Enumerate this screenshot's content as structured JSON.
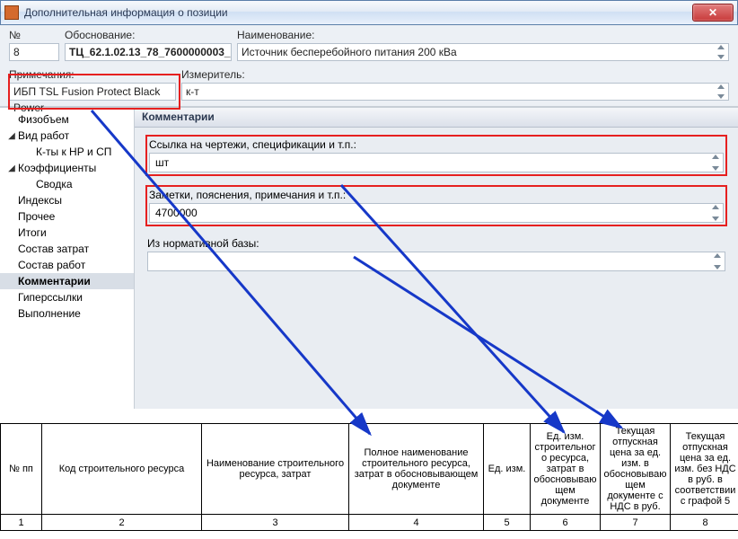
{
  "window": {
    "title": "Дополнительная информация о позиции"
  },
  "form": {
    "labels": {
      "no": "№",
      "obosn": "Обоснование:",
      "naim": "Наименование:",
      "prim": "Примечания:",
      "izm": "Измеритель:"
    },
    "values": {
      "no": "8",
      "obosn": "ТЦ_62.1.02.13_78_7600000003_",
      "naim": "Источник бесперебойного питания 200 кВа",
      "prim": "ИБП TSL Fusion Protect Black Power",
      "izm": "к-т"
    }
  },
  "sidebar": {
    "items": [
      {
        "label": "Физобъем",
        "caret": "",
        "cls": ""
      },
      {
        "label": "Вид работ",
        "caret": "◢",
        "cls": ""
      },
      {
        "label": "К-ты к НР и СП",
        "caret": "",
        "cls": "child"
      },
      {
        "label": "Коэффициенты",
        "caret": "◢",
        "cls": ""
      },
      {
        "label": "Сводка",
        "caret": "",
        "cls": "child"
      },
      {
        "label": "Индексы",
        "caret": "",
        "cls": ""
      },
      {
        "label": "Прочее",
        "caret": "",
        "cls": ""
      },
      {
        "label": "Итоги",
        "caret": "",
        "cls": ""
      },
      {
        "label": "Состав затрат",
        "caret": "",
        "cls": ""
      },
      {
        "label": "Состав работ",
        "caret": "",
        "cls": ""
      },
      {
        "label": "Комментарии",
        "caret": "",
        "cls": "selected"
      },
      {
        "label": "Гиперссылки",
        "caret": "",
        "cls": ""
      },
      {
        "label": "Выполнение",
        "caret": "",
        "cls": ""
      }
    ]
  },
  "comments": {
    "header": "Комментарии",
    "group1": {
      "label": "Ссылка на чертежи, спецификации и т.п.:",
      "value": "шт"
    },
    "group2": {
      "label": "Заметки, пояснения, примечания и т.п.:",
      "value": "4700000"
    },
    "group3": {
      "label": "Из нормативной базы:",
      "value": ""
    }
  },
  "table": {
    "headers": [
      "№ пп",
      "Код строительного ресурса",
      "Наименование строительного ресурса, затрат",
      "Полное наименование строительного ресурса, затрат в обосновывающем документе",
      "Ед. изм.",
      "Ед. изм. строительного ресурса, затрат в обосновывающем документе",
      "Текущая отпускная цена за ед. изм. в обосновывающем документе с НДС в руб.",
      "Текущая отпускная цена за ед. изм. без НДС в руб. в соответствии с графой 5"
    ],
    "nums": [
      "1",
      "2",
      "3",
      "4",
      "5",
      "6",
      "7",
      "8"
    ]
  },
  "colors": {
    "highlight": "#e62020",
    "arrow": "#1638c8"
  }
}
